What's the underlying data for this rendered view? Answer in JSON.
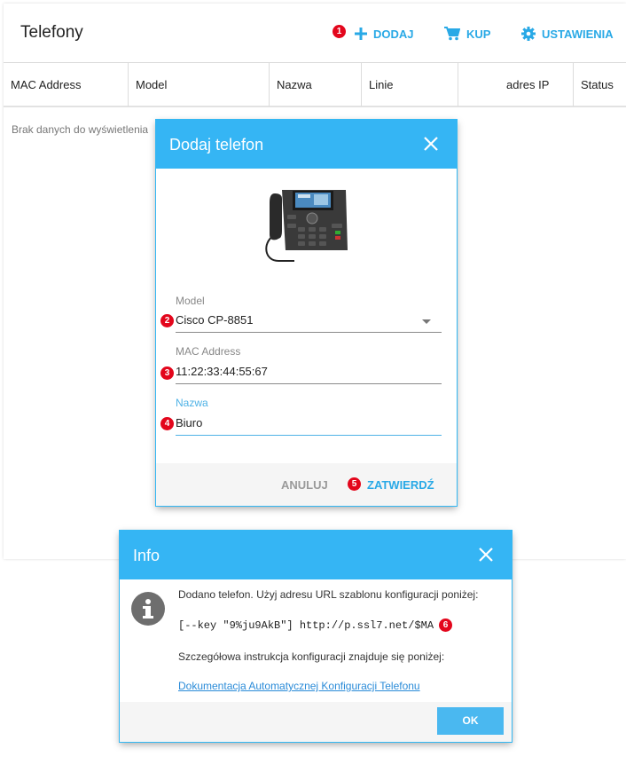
{
  "header": {
    "title": "Telefony",
    "add_label": "DODAJ",
    "buy_label": "KUP",
    "settings_label": "USTAWIENIA"
  },
  "table": {
    "columns": [
      "MAC Address",
      "Model",
      "Nazwa",
      "Linie",
      "adres IP",
      "Status"
    ],
    "empty_text": "Brak danych do wyświetlenia"
  },
  "add_dialog": {
    "title": "Dodaj telefon",
    "model_label": "Model",
    "model_value": "Cisco CP-8851",
    "mac_label": "MAC Address",
    "mac_value": "11:22:33:44:55:67",
    "name_label": "Nazwa",
    "name_value": "Biuro",
    "cancel_label": "ANULUJ",
    "confirm_label": "ZATWIERDŹ"
  },
  "info_dialog": {
    "title": "Info",
    "message": "Dodano telefon. Użyj adresu URL szablonu konfiguracji poniżej:",
    "code": "[--key \"9%ju9AkB\"] http://p.ssl7.net/$MA",
    "instruction": "Szczegółowa instrukcja konfiguracji znajduje się poniżej:",
    "link_text": "Dokumentacja Automatycznej Konfiguracji Telefonu",
    "ok_label": "OK"
  },
  "badges": [
    "1",
    "2",
    "3",
    "4",
    "5",
    "6"
  ],
  "icons": {
    "add": "plus-icon",
    "buy": "cart-icon",
    "settings": "gear-icon",
    "close": "close-icon",
    "info": "info-icon",
    "dropdown": "chevron-down-icon"
  },
  "colors": {
    "accent": "#35b5f4",
    "link": "#2a8bd8",
    "badge": "#e3061c"
  }
}
